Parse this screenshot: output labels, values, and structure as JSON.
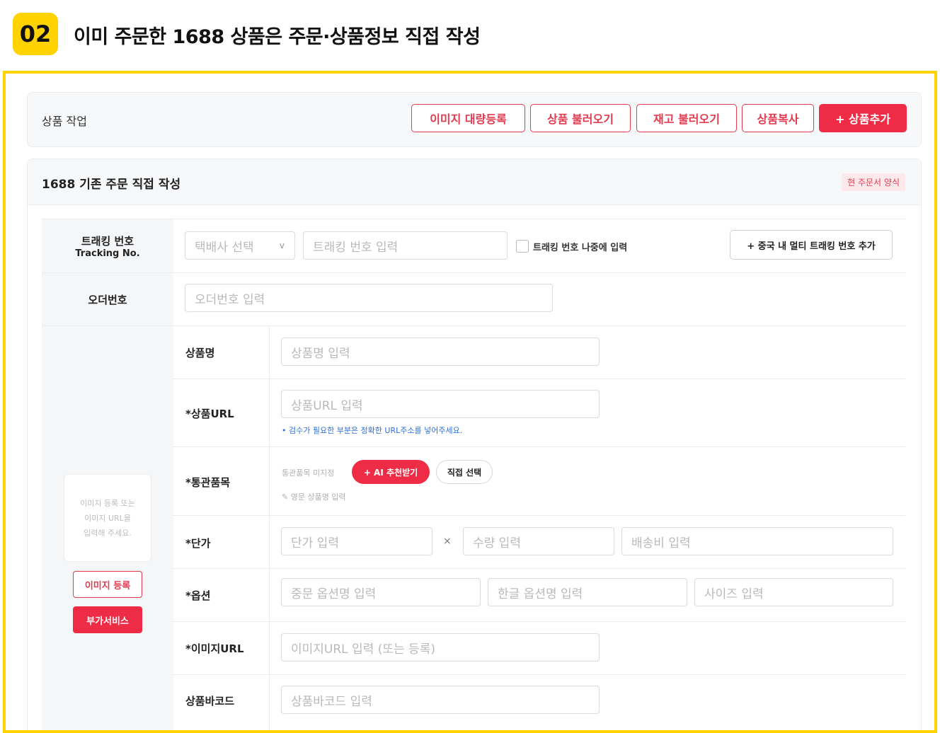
{
  "header": {
    "step_number": "02",
    "title": "이미 주문한 1688 상품은 주문·상품정보 직접 작성"
  },
  "toolbar": {
    "label": "상품 작업",
    "buttons": [
      "이미지 대량등록",
      "상품 불러오기",
      "재고 불러오기",
      "상품복사",
      "+ 상품추가"
    ]
  },
  "card": {
    "title": "1688 기존 주문 직접 작성",
    "tag": "현 주문서 양식"
  },
  "tracking": {
    "label": "트래킹 번호",
    "label_en": "Tracking No.",
    "courier_placeholder": "택배사 선택",
    "courier_caret": "v",
    "number_placeholder": "트래킹 번호 입력",
    "later_label": "트래킹 번호 나중에 입력",
    "multi_button": "+ 중국 내 멀티 트래킹 번호 추가"
  },
  "order": {
    "label": "오더번호",
    "placeholder": "오더번호 입력"
  },
  "image_panel": {
    "placeholder": "이미지 등록 또는\n이미지 URL을\n입력해 주세요.",
    "register_button": "이미지 등록",
    "extra_button": "부가서비스"
  },
  "product": {
    "name_label": "상품명",
    "name_placeholder": "상품명 입력",
    "url_label": "*상품URL",
    "url_placeholder": "상품URL 입력",
    "url_hint": "• 검수가 필요한 부분은 정확한 URL주소를 넣어주세요.",
    "customs_label": "*통관품목",
    "customs_status": "통관품목 미지정",
    "ai_button": "+ AI 추천받기",
    "direct_button": "직접 선택",
    "customs_sub": "✎ 영문 상품명 입력",
    "price_label": "*단가",
    "price_placeholder": "단가 입력",
    "times": "×",
    "qty_placeholder": "수량 입력",
    "shipping_placeholder": "배송비 입력",
    "option_label": "*옵션",
    "option_cn_placeholder": "중문 옵션명 입력",
    "option_kr_placeholder": "한글 옵션명 입력",
    "size_placeholder": "사이즈 입력",
    "image_url_label": "*이미지URL",
    "image_url_placeholder": "이미지URL 입력 (또는 등록)",
    "barcode_label": "상품바코드",
    "barcode_placeholder": "상품바코드 입력"
  },
  "colors": {
    "accent": "#ef2c45",
    "frame": "#ffd200",
    "hint": "#2f6fd6"
  }
}
